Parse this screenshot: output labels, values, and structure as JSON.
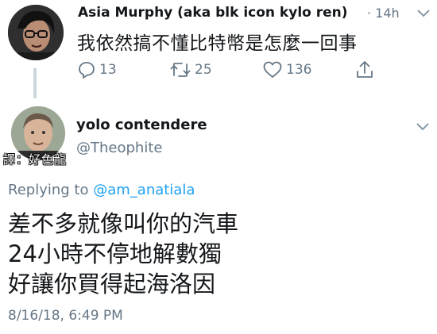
{
  "top_tweet": {
    "author_name": "Asia Murphy (aka blk icon kylo ren)",
    "time": "· 14h",
    "text": "我依然搞不懂比特幣是怎麼一回事",
    "actions": {
      "reply_count": "13",
      "retweet_count": "25",
      "like_count": "136"
    }
  },
  "reply_tweet": {
    "author_name": "yolo contendere",
    "handle": "@Theophite",
    "watermark": "譯：好色龍",
    "replying_prefix": "Replying to",
    "replying_to": "@am_anatiala",
    "text_lines": [
      "差不多就像叫你的汽車",
      "24小時不停地解數獨",
      "好讓你買得起海洛因"
    ],
    "timestamp": "8/16/18, 6:49 PM"
  },
  "colors": {
    "text": "#14171a",
    "muted": "#657786",
    "link": "#1da1f2",
    "divider": "#ccd6dd"
  },
  "icons": [
    "reply-icon",
    "retweet-icon",
    "like-icon",
    "share-icon",
    "chevron-down-icon"
  ]
}
